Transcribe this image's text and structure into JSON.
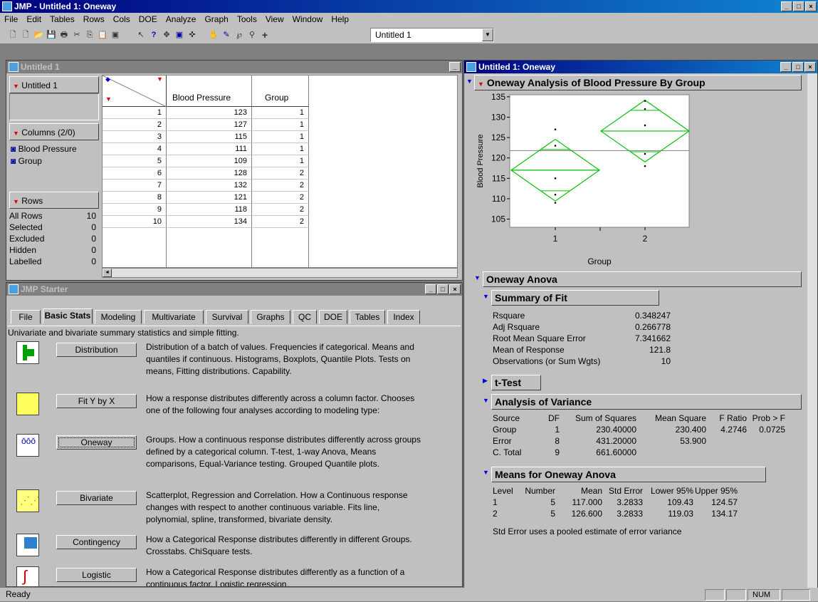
{
  "app": {
    "title": "JMP - Untitled 1: Oneway",
    "menu": [
      "File",
      "Edit",
      "Tables",
      "Rows",
      "Cols",
      "DOE",
      "Analyze",
      "Graph",
      "Tools",
      "View",
      "Window",
      "Help"
    ],
    "toolbar_combo": "Untitled 1"
  },
  "datatable": {
    "window_title": "Untitled 1",
    "table_name": "Untitled 1",
    "columns_header": "Columns (2/0)",
    "columns": [
      "Blood Pressure",
      "Group"
    ],
    "rows_header": "Rows",
    "row_states": [
      {
        "label": "All Rows",
        "value": "10"
      },
      {
        "label": "Selected",
        "value": "0"
      },
      {
        "label": "Excluded",
        "value": "0"
      },
      {
        "label": "Hidden",
        "value": "0"
      },
      {
        "label": "Labelled",
        "value": "0"
      }
    ],
    "col_headers": [
      "Blood Pressure",
      "Group"
    ],
    "rows": [
      [
        "1",
        "123",
        "1"
      ],
      [
        "2",
        "127",
        "1"
      ],
      [
        "3",
        "115",
        "1"
      ],
      [
        "4",
        "111",
        "1"
      ],
      [
        "5",
        "109",
        "1"
      ],
      [
        "6",
        "128",
        "2"
      ],
      [
        "7",
        "132",
        "2"
      ],
      [
        "8",
        "121",
        "2"
      ],
      [
        "9",
        "118",
        "2"
      ],
      [
        "10",
        "134",
        "2"
      ]
    ]
  },
  "starter": {
    "window_title": "JMP Starter",
    "tabs": [
      "File",
      "Basic Stats",
      "Modeling",
      "Multivariate",
      "Survival",
      "Graphs",
      "QC",
      "DOE",
      "Tables",
      "Index"
    ],
    "active_tab": "Basic Stats",
    "intro": "Univariate and bivariate summary statistics and simple fitting.",
    "items": [
      {
        "label": "Distribution",
        "desc": "Distribution of a batch of values. Frequencies if categorical. Means and quantiles if continuous. Histograms, Boxplots, Quantile Plots. Tests on means, Fitting distributions. Capability.",
        "icon": "distribution-icon"
      },
      {
        "label": "Fit Y by X",
        "desc": "How a response distributes differently across a column factor. Chooses one of the following four analyses according to modeling type:",
        "icon": "fit-y-by-x-icon"
      },
      {
        "label": "Oneway",
        "desc": "Groups. How a continuous response distributes differently across groups defined by a categorical column. T-test, 1-way Anova, Means comparisons, Equal-Variance testing. Grouped Quantile plots.",
        "icon": "oneway-icon"
      },
      {
        "label": "Bivariate",
        "desc": "Scatterplot, Regression and Correlation. How a Continuous response changes with respect to another continuous variable. Fits line, polynomial, spline, transformed, bivariate density.",
        "icon": "bivariate-icon"
      },
      {
        "label": "Contingency",
        "desc": "How a Categorical Response distributes differently in different Groups. Crosstabs. ChiSquare tests.",
        "icon": "contingency-icon"
      },
      {
        "label": "Logistic",
        "desc": "How a Categorical Response distributes differently as a function of a continuous factor. Logistic regression.",
        "icon": "logistic-icon"
      }
    ]
  },
  "report": {
    "window_title": "Untitled 1: Oneway",
    "main_title": "Oneway Analysis of Blood Pressure By Group",
    "anova_title": "Oneway Anova",
    "summary_title": "Summary of Fit",
    "summary": [
      {
        "label": "Rsquare",
        "value": "0.348247"
      },
      {
        "label": "Adj Rsquare",
        "value": "0.266778"
      },
      {
        "label": "Root Mean Square Error",
        "value": "7.341662"
      },
      {
        "label": "Mean of Response",
        "value": "121.8"
      },
      {
        "label": "Observations (or Sum Wgts)",
        "value": "10"
      }
    ],
    "ttest_title": "t-Test",
    "aov_title": "Analysis of Variance",
    "aov_headers": [
      "Source",
      "DF",
      "Sum of Squares",
      "Mean Square",
      "F Ratio",
      "Prob > F"
    ],
    "aov_rows": [
      [
        "Group",
        "1",
        "230.40000",
        "230.400",
        "4.2746",
        "0.0725"
      ],
      [
        "Error",
        "8",
        "431.20000",
        "53.900",
        "",
        ""
      ],
      [
        "C. Total",
        "9",
        "661.60000",
        "",
        "",
        ""
      ]
    ],
    "means_title": "Means for Oneway Anova",
    "means_headers": [
      "Level",
      "Number",
      "Mean",
      "Std Error",
      "Lower 95%",
      "Upper 95%"
    ],
    "means_rows": [
      [
        "1",
        "5",
        "117.000",
        "3.2833",
        "109.43",
        "124.57"
      ],
      [
        "2",
        "5",
        "126.600",
        "3.2833",
        "119.03",
        "134.17"
      ]
    ],
    "means_note": "Std Error uses a pooled estimate of error variance"
  },
  "chart_data": {
    "type": "scatter",
    "xlabel": "Group",
    "ylabel": "Blood Pressure",
    "categories": [
      "1",
      "2"
    ],
    "ylim": [
      103,
      135.5
    ],
    "yticks": [
      105,
      110,
      115,
      120,
      125,
      130,
      135
    ],
    "grand_mean": 121.8,
    "series": [
      {
        "category": "1",
        "values": [
          123,
          127,
          115,
          111,
          109
        ],
        "mean": 117.0,
        "lower95": 109.43,
        "upper95": 124.57
      },
      {
        "category": "2",
        "values": [
          128,
          132,
          121,
          118,
          134
        ],
        "mean": 126.6,
        "lower95": 119.03,
        "upper95": 134.17
      }
    ],
    "diamond_color": "#00c000"
  },
  "status": {
    "text": "Ready",
    "num": "NUM"
  }
}
